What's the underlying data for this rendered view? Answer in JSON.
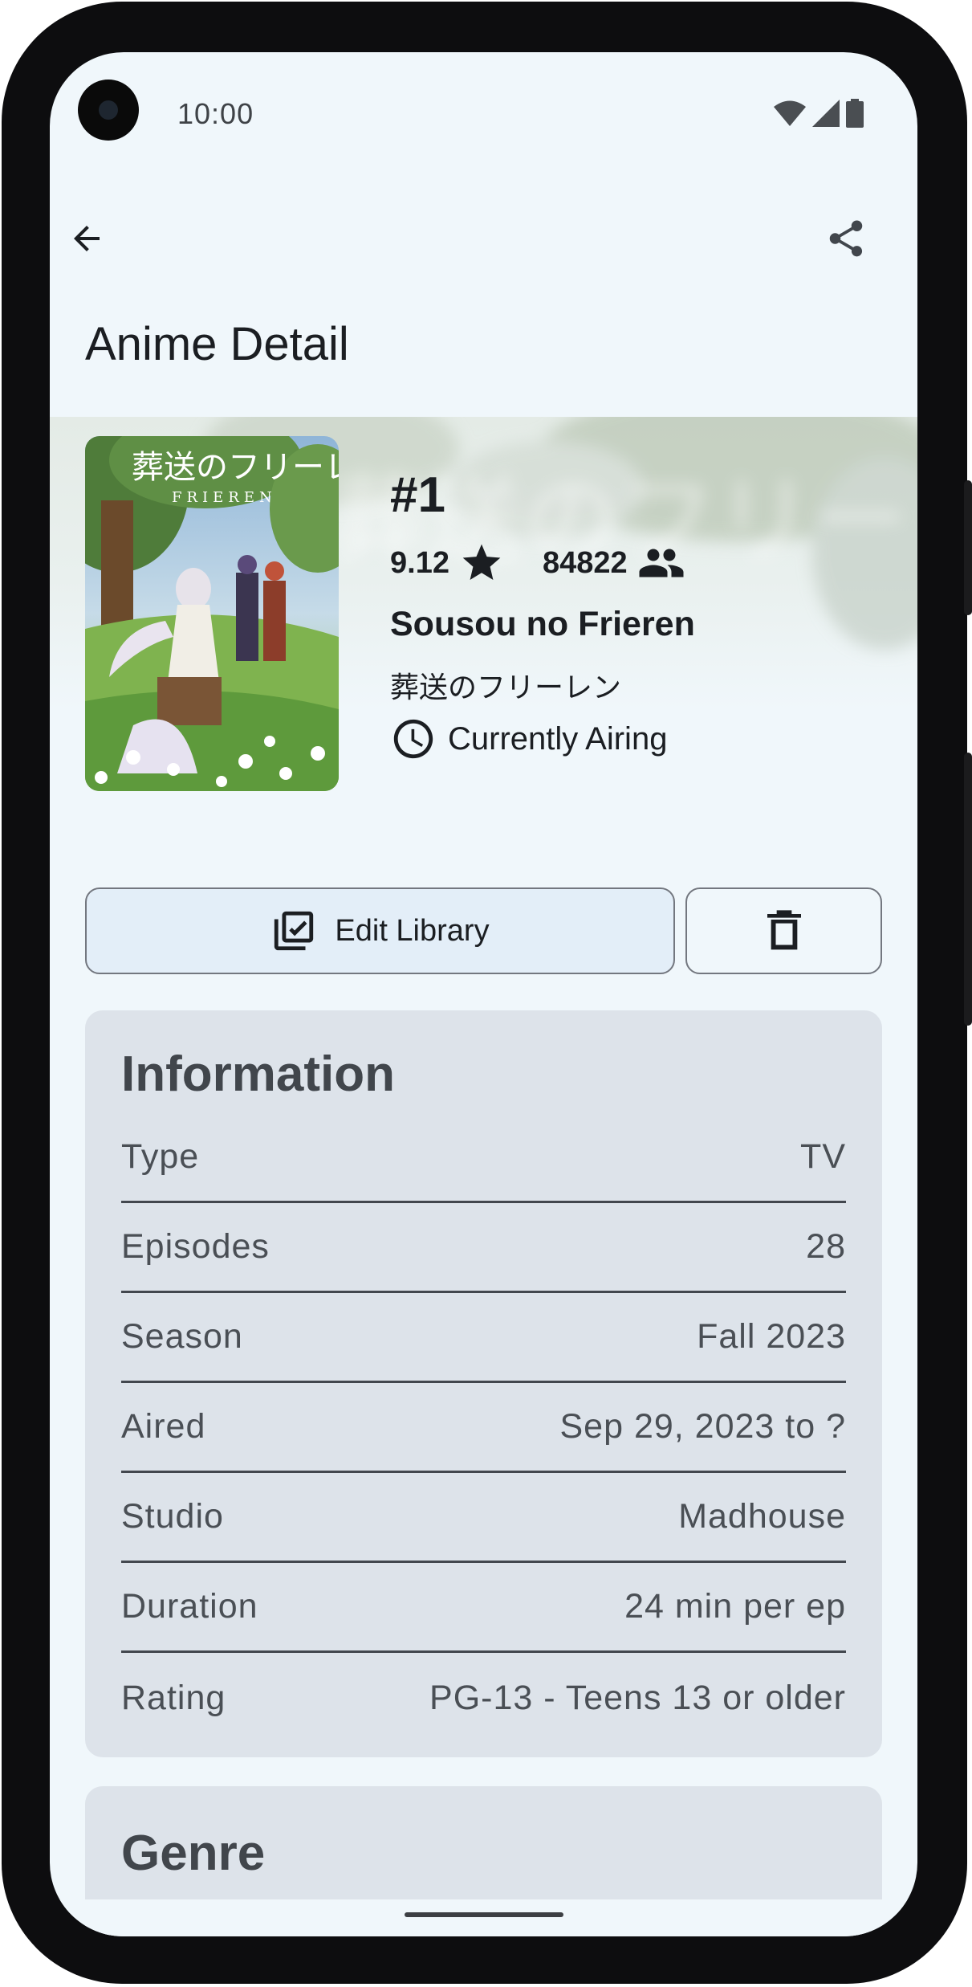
{
  "status_bar": {
    "time": "10:00",
    "icons": [
      "wifi-icon",
      "cell-signal-icon",
      "battery-icon"
    ]
  },
  "toolbar": {
    "back_icon": "arrow-back-icon",
    "share_icon": "share-icon"
  },
  "page": {
    "title": "Anime Detail"
  },
  "anime": {
    "rank": "#1",
    "score": "9.12",
    "members": "84822",
    "title_en": "Sousou no Frieren",
    "title_jp": "葬送のフリーレン",
    "status": "Currently Airing",
    "poster_title": "葬送のフリーレン",
    "poster_subtitle": "FRIEREN"
  },
  "actions": {
    "edit_label": "Edit Library",
    "delete_icon": "trash-icon"
  },
  "information": {
    "heading": "Information",
    "rows": [
      {
        "label": "Type",
        "value": "TV"
      },
      {
        "label": "Episodes",
        "value": "28"
      },
      {
        "label": "Season",
        "value": "Fall 2023"
      },
      {
        "label": "Aired",
        "value": "Sep 29, 2023 to ?"
      },
      {
        "label": "Studio",
        "value": "Madhouse"
      },
      {
        "label": "Duration",
        "value": "24 min per ep"
      },
      {
        "label": "Rating",
        "value": "PG-13 - Teens 13 or older"
      }
    ]
  },
  "genre": {
    "heading": "Genre"
  },
  "colors": {
    "surface": "#f0f7fb",
    "card": "#dde3ea",
    "edit_button_bg": "#e3eef8",
    "on_surface": "#1b1e22"
  }
}
